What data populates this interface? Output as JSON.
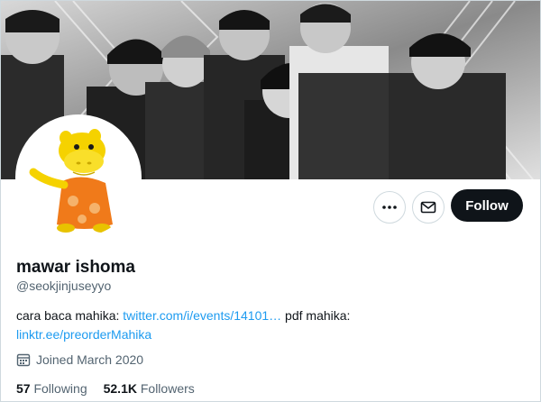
{
  "profile": {
    "display_name": "mawar ishoma",
    "handle": "@seokjinjuseyyo",
    "bio": {
      "text1": "cara baca mahika: ",
      "link1": "twitter.com/i/events/14101…",
      "text2": " pdf mahika:",
      "link2": "linktr.ee/preorderMahika"
    },
    "joined": "Joined March 2020",
    "following_count": "57",
    "following_label": "Following",
    "followers_count": "52.1K",
    "followers_label": "Followers"
  },
  "actions": {
    "follow_label": "Follow",
    "more_icon": "more-icon",
    "message_icon": "mail-icon"
  },
  "colors": {
    "accent": "#1d9bf0",
    "follow_bg": "#0f1419",
    "muted": "#536471"
  }
}
